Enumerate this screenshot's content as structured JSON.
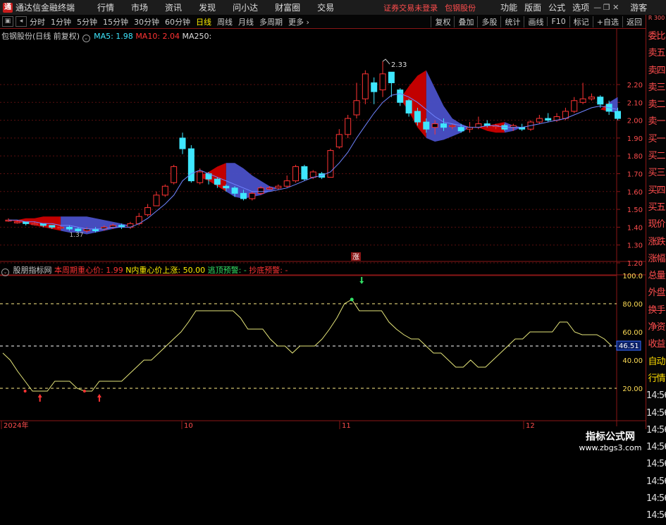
{
  "menubar": {
    "logo": "通",
    "app_title": "通达信金融终端",
    "items": [
      "行情",
      "市场",
      "资讯",
      "发现",
      "问小达",
      "财富圈",
      "交易"
    ],
    "login_warning": "证券交易未登录",
    "stock_name": "包钢股份",
    "sys_items": [
      "功能",
      "版面",
      "公式",
      "选项"
    ],
    "guest_label": "游客"
  },
  "toolbar": {
    "periods": [
      "分时",
      "1分钟",
      "5分钟",
      "15分钟",
      "30分钟",
      "60分钟",
      "日线",
      "周线",
      "月线",
      "多周期",
      "更多"
    ],
    "active_period": "日线",
    "right_buttons": [
      "复权",
      "叠加",
      "多股",
      "统计",
      "画线",
      "F10",
      "标记",
      "+自选",
      "返回"
    ]
  },
  "sidepanel": {
    "corner": "R 300",
    "items": [
      "委比",
      "卖五",
      "卖四",
      "卖三",
      "卖二",
      "卖一",
      "买一",
      "买二",
      "买三",
      "买四",
      "买五",
      "现价",
      "涨跌",
      "涨幅",
      "总量",
      "外盘",
      "换手",
      "净资",
      "收益",
      "自动",
      "行情",
      "14:56",
      "14:56",
      "14:56",
      "14:56",
      "14:56",
      "14:56",
      "14:56",
      "14:56"
    ]
  },
  "main_legend": {
    "title": "包钢股份(日线 前复权)",
    "ma5": "MA5: 1.98",
    "ma10": "MA10: 2.04",
    "ma250": "MA250:",
    "ma5_color": "#3fe7ff",
    "ma10_color": "#ff3333"
  },
  "sub_legend": {
    "title": "股朋指标网",
    "item1": "本周期重心价: 1.99",
    "item2": "N内重心价上涨: 50.00",
    "item3": "逃顶预警: -",
    "item4": "抄底预警: -"
  },
  "main_axis": [
    "2.20",
    "2.10",
    "2.00",
    "1.90",
    "1.80",
    "1.70",
    "1.60",
    "1.50",
    "1.40",
    "1.30",
    "1.20"
  ],
  "sub_axis": [
    "100.0",
    "80.00",
    "60.00",
    "40.00",
    "20.00"
  ],
  "sub_current": "46.51",
  "annotations": {
    "high": "2.33",
    "low": "1.37",
    "zhang": "涨"
  },
  "time_axis": [
    "2024年",
    "10",
    "11",
    "12"
  ],
  "watermark": {
    "title": "指标公式网",
    "url": "www.zbgs3.com"
  },
  "colors": {
    "up": "#ff3333",
    "down": "#3fe7ff",
    "ribbon_red": "#cc0000",
    "ribbon_blue": "#4a50c8",
    "osc": "#e6e67a"
  },
  "chart_data": {
    "type": "candlestick",
    "unit": "CNY",
    "candles": [
      [
        1.44,
        1.44,
        1.45,
        1.43
      ],
      [
        1.43,
        1.43,
        1.44,
        1.42
      ],
      [
        1.43,
        1.42,
        1.43,
        1.41
      ],
      [
        1.42,
        1.42,
        1.43,
        1.41
      ],
      [
        1.42,
        1.41,
        1.42,
        1.4
      ],
      [
        1.41,
        1.4,
        1.41,
        1.39
      ],
      [
        1.4,
        1.4,
        1.41,
        1.39
      ],
      [
        1.4,
        1.39,
        1.41,
        1.38
      ],
      [
        1.39,
        1.38,
        1.4,
        1.37
      ],
      [
        1.38,
        1.39,
        1.4,
        1.37
      ],
      [
        1.39,
        1.38,
        1.4,
        1.37
      ],
      [
        1.39,
        1.4,
        1.41,
        1.38
      ],
      [
        1.4,
        1.41,
        1.42,
        1.39
      ],
      [
        1.41,
        1.4,
        1.42,
        1.39
      ],
      [
        1.4,
        1.42,
        1.43,
        1.39
      ],
      [
        1.42,
        1.46,
        1.48,
        1.41
      ],
      [
        1.47,
        1.51,
        1.53,
        1.46
      ],
      [
        1.52,
        1.58,
        1.6,
        1.52
      ],
      [
        1.58,
        1.63,
        1.64,
        1.57
      ],
      [
        1.65,
        1.74,
        1.75,
        1.64
      ],
      [
        1.9,
        1.84,
        1.93,
        1.81
      ],
      [
        1.84,
        1.66,
        1.86,
        1.65
      ],
      [
        1.65,
        1.71,
        1.73,
        1.64
      ],
      [
        1.7,
        1.67,
        1.71,
        1.64
      ],
      [
        1.67,
        1.64,
        1.68,
        1.62
      ],
      [
        1.63,
        1.62,
        1.64,
        1.6
      ],
      [
        1.62,
        1.59,
        1.63,
        1.57
      ],
      [
        1.59,
        1.56,
        1.61,
        1.55
      ],
      [
        1.56,
        1.59,
        1.6,
        1.55
      ],
      [
        1.59,
        1.62,
        1.63,
        1.58
      ],
      [
        1.62,
        1.62,
        1.63,
        1.61
      ],
      [
        1.62,
        1.63,
        1.64,
        1.61
      ],
      [
        1.63,
        1.66,
        1.69,
        1.62
      ],
      [
        1.66,
        1.74,
        1.75,
        1.65
      ],
      [
        1.74,
        1.67,
        1.75,
        1.66
      ],
      [
        1.68,
        1.71,
        1.72,
        1.67
      ],
      [
        1.7,
        1.68,
        1.71,
        1.67
      ],
      [
        1.68,
        1.83,
        1.84,
        1.68
      ],
      [
        1.85,
        1.92,
        1.95,
        1.84
      ],
      [
        1.92,
        2.01,
        2.03,
        1.9
      ],
      [
        2.03,
        2.11,
        2.21,
        2.01
      ],
      [
        2.12,
        2.26,
        2.28,
        2.09
      ],
      [
        2.21,
        2.16,
        2.24,
        2.09
      ],
      [
        2.17,
        2.26,
        2.33,
        2.13
      ],
      [
        2.27,
        2.21,
        2.25,
        2.13
      ],
      [
        2.17,
        2.1,
        2.18,
        2.08
      ],
      [
        2.11,
        2.04,
        2.12,
        2.02
      ],
      [
        2.05,
        1.99,
        2.07,
        1.97
      ],
      [
        1.99,
        1.95,
        2.01,
        1.93
      ],
      [
        1.96,
        1.98,
        2.0,
        1.92
      ],
      [
        1.98,
        1.96,
        2.01,
        1.94
      ],
      [
        1.97,
        1.97,
        1.98,
        1.95
      ],
      [
        1.96,
        1.94,
        1.98,
        1.93
      ],
      [
        1.95,
        1.96,
        1.99,
        1.93
      ],
      [
        1.96,
        1.98,
        2.02,
        1.95
      ],
      [
        1.98,
        1.97,
        2.0,
        1.96
      ],
      [
        1.97,
        1.97,
        1.98,
        1.95
      ],
      [
        1.97,
        1.95,
        1.98,
        1.94
      ],
      [
        1.96,
        1.97,
        1.98,
        1.94
      ],
      [
        1.96,
        1.95,
        1.98,
        1.94
      ],
      [
        1.95,
        1.99,
        2.0,
        1.94
      ],
      [
        1.99,
        2.01,
        2.03,
        1.98
      ],
      [
        2.01,
        2.0,
        2.04,
        1.99
      ],
      [
        2.0,
        2.02,
        2.04,
        1.99
      ],
      [
        2.01,
        2.05,
        2.07,
        2.0
      ],
      [
        2.05,
        2.11,
        2.13,
        2.04
      ],
      [
        2.1,
        2.12,
        2.21,
        2.09
      ],
      [
        2.12,
        2.13,
        2.15,
        2.11
      ],
      [
        2.13,
        2.09,
        2.14,
        2.07
      ],
      [
        2.09,
        2.05,
        2.11,
        2.03
      ],
      [
        2.05,
        2.01,
        2.07,
        2.0
      ]
    ],
    "ma_line": [
      1.44,
      1.44,
      1.43,
      1.43,
      1.42,
      1.42,
      1.41,
      1.41,
      1.4,
      1.39,
      1.39,
      1.39,
      1.4,
      1.4,
      1.4,
      1.42,
      1.45,
      1.49,
      1.53,
      1.58,
      1.66,
      1.7,
      1.72,
      1.7,
      1.68,
      1.66,
      1.64,
      1.62,
      1.6,
      1.6,
      1.6,
      1.61,
      1.62,
      1.64,
      1.66,
      1.68,
      1.69,
      1.71,
      1.76,
      1.82,
      1.9,
      1.97,
      2.04,
      2.1,
      2.14,
      2.15,
      2.13,
      2.1,
      2.06,
      2.02,
      1.99,
      1.98,
      1.97,
      1.96,
      1.96,
      1.97,
      1.97,
      1.96,
      1.96,
      1.96,
      1.97,
      1.98,
      1.99,
      2.0,
      2.01,
      2.03,
      2.05,
      2.07,
      2.08,
      2.07,
      2.06
    ],
    "ribbons": [
      {
        "from": 0,
        "to": 14,
        "upper": [
          1.44,
          1.44,
          1.45,
          1.45,
          1.46,
          1.46,
          1.46,
          1.46,
          1.46,
          1.46,
          1.45,
          1.44,
          1.43,
          1.42,
          1.41
        ],
        "lower": [
          1.44,
          1.43,
          1.42,
          1.41,
          1.4,
          1.39,
          1.38,
          1.37,
          1.37,
          1.36,
          1.37,
          1.38,
          1.39,
          1.4,
          1.41
        ],
        "split": 6
      },
      {
        "from": 22,
        "to": 31,
        "upper": [
          1.69,
          1.71,
          1.74,
          1.76,
          1.76,
          1.73,
          1.69,
          1.66,
          1.63,
          1.62
        ],
        "lower": [
          1.68,
          1.66,
          1.63,
          1.6,
          1.57,
          1.56,
          1.57,
          1.58,
          1.6,
          1.62
        ],
        "split": 25
      },
      {
        "from": 45,
        "to": 53,
        "upper": [
          2.12,
          2.19,
          2.25,
          2.28,
          2.18,
          2.08,
          2.01,
          1.98,
          1.96
        ],
        "lower": [
          2.12,
          2.05,
          1.96,
          1.9,
          1.88,
          1.89,
          1.91,
          1.93,
          1.96
        ],
        "split": 48
      },
      {
        "from": 54,
        "to": 59,
        "upper": [
          1.96,
          1.97,
          1.98,
          1.99,
          1.97,
          1.96
        ],
        "lower": [
          1.96,
          1.94,
          1.93,
          1.93,
          1.94,
          1.96
        ],
        "split": 57
      },
      {
        "from": 68,
        "to": 70,
        "upper": [
          2.06,
          2.1,
          2.13
        ],
        "lower": [
          2.06,
          2.05,
          2.04
        ],
        "split": 69
      }
    ],
    "oscillator": {
      "range": [
        0,
        100
      ],
      "levels_dashed": [
        80,
        50,
        20
      ],
      "level_solid": 100,
      "values": [
        45,
        40,
        32,
        25,
        18,
        18,
        18,
        25,
        25,
        25,
        20,
        18,
        18,
        25,
        25,
        25,
        25,
        30,
        35,
        40,
        40,
        45,
        50,
        55,
        60,
        67,
        75,
        75,
        75,
        75,
        75,
        75,
        70,
        62,
        62,
        62,
        55,
        50,
        50,
        45,
        50,
        50,
        50,
        55,
        62,
        70,
        80,
        83,
        75,
        75,
        75,
        75,
        67,
        62,
        58,
        55,
        55,
        50,
        45,
        45,
        40,
        35,
        35,
        40,
        35,
        35,
        40,
        45,
        50,
        55,
        55,
        60,
        60,
        60,
        60,
        67,
        67,
        60,
        58,
        58,
        58,
        55,
        50
      ]
    }
  }
}
